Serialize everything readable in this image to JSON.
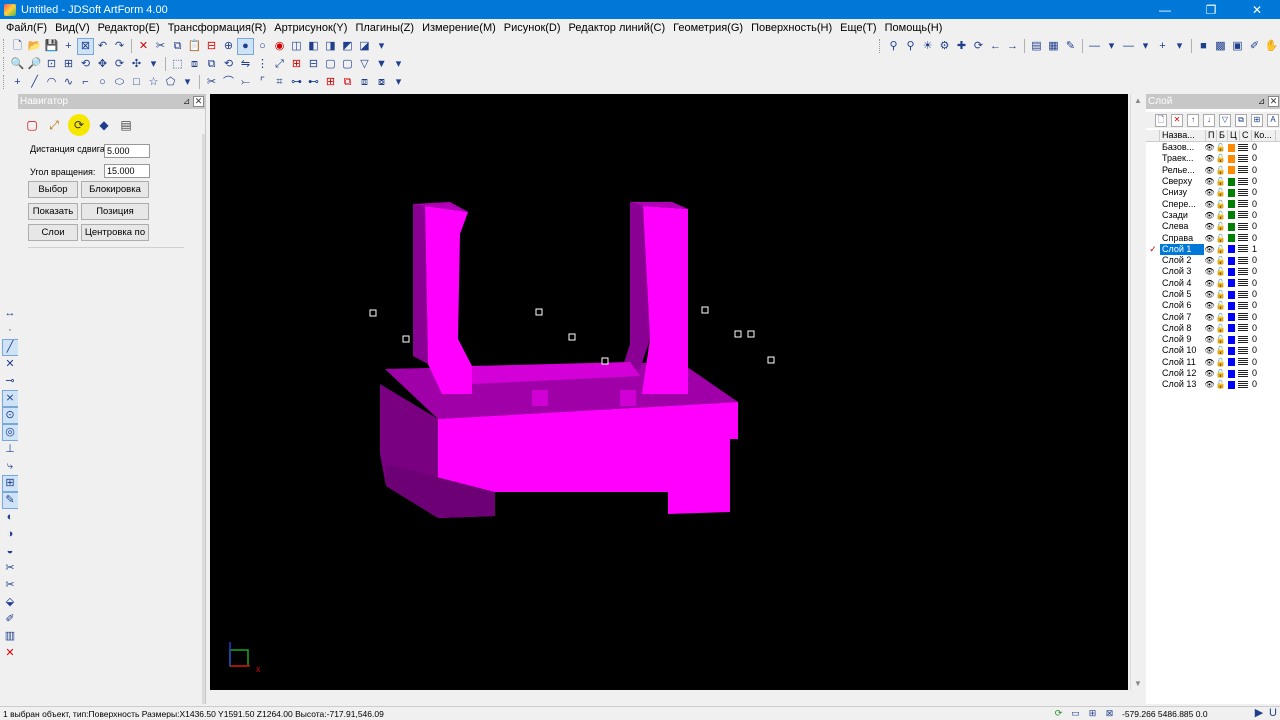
{
  "window": {
    "title": "Untitled - JDSoft ArtForm 4.00",
    "minimize": "—",
    "maximize": "❐",
    "close": "✕"
  },
  "menu": [
    "Файл(F)",
    "Вид(V)",
    "Редактор(E)",
    "Трансформация(R)",
    "Артрисунок(Y)",
    "Плагины(Z)",
    "Измерение(M)",
    "Рисунок(D)",
    "Редактор линий(C)",
    "Геометрия(G)",
    "Поверхность(H)",
    "Еще(T)",
    "Помощь(H)"
  ],
  "navigator": {
    "title": "Навигатор",
    "shift_label": "Дистанция сдвига:",
    "shift_value": "5.000",
    "rotate_label": "Угол вращения:",
    "rotate_value": "15.000",
    "buttons": {
      "select": "Выбор",
      "lock": "Блокировка",
      "show": "Показать",
      "position": "Позиция",
      "layers": "Слои",
      "center": "Центровка по"
    }
  },
  "layers": {
    "title": "Слой",
    "columns": [
      "Назва...",
      "П",
      "Б",
      "Ц",
      "С",
      "Ко..."
    ],
    "rows": [
      {
        "name": "Базов...",
        "color": "#ff8c00",
        "count": "0",
        "selected": false
      },
      {
        "name": "Траек...",
        "color": "#ff8c00",
        "count": "0",
        "selected": false
      },
      {
        "name": "Релье...",
        "color": "#ff8c00",
        "count": "0",
        "selected": false
      },
      {
        "name": "Сверху",
        "color": "#008000",
        "count": "0",
        "selected": false
      },
      {
        "name": "Снизу",
        "color": "#008000",
        "count": "0",
        "selected": false
      },
      {
        "name": "Спере...",
        "color": "#008000",
        "count": "0",
        "selected": false
      },
      {
        "name": "Сзади",
        "color": "#008000",
        "count": "0",
        "selected": false
      },
      {
        "name": "Слева",
        "color": "#008000",
        "count": "0",
        "selected": false
      },
      {
        "name": "Справа",
        "color": "#008000",
        "count": "0",
        "selected": false
      },
      {
        "name": "Слой 1",
        "color": "#0000ff",
        "count": "1",
        "selected": true
      },
      {
        "name": "Слой 2",
        "color": "#0000ff",
        "count": "0",
        "selected": false
      },
      {
        "name": "Слой 3",
        "color": "#0000ff",
        "count": "0",
        "selected": false
      },
      {
        "name": "Слой 4",
        "color": "#0000ff",
        "count": "0",
        "selected": false
      },
      {
        "name": "Слой 5",
        "color": "#0000ff",
        "count": "0",
        "selected": false
      },
      {
        "name": "Слой 6",
        "color": "#0000ff",
        "count": "0",
        "selected": false
      },
      {
        "name": "Слой 7",
        "color": "#0000ff",
        "count": "0",
        "selected": false
      },
      {
        "name": "Слой 8",
        "color": "#0000ff",
        "count": "0",
        "selected": false
      },
      {
        "name": "Слой 9",
        "color": "#0000ff",
        "count": "0",
        "selected": false
      },
      {
        "name": "Слой 10",
        "color": "#0000ff",
        "count": "0",
        "selected": false
      },
      {
        "name": "Слой 11",
        "color": "#0000ff",
        "count": "0",
        "selected": false
      },
      {
        "name": "Слой 12",
        "color": "#0000ff",
        "count": "0",
        "selected": false
      },
      {
        "name": "Слой 13",
        "color": "#0000ff",
        "count": "0",
        "selected": false
      }
    ]
  },
  "status": {
    "message": "1 выбран объект, тип:Поверхность  Размеры:X1436.50 Y1591.50 Z1264.00 Высота:-717.91,546.09",
    "coords": "-579.266  5486.885  0.0"
  },
  "colors": {
    "accent": "#0078d7",
    "model": "#ff00ff",
    "model_shade": "#a000a8",
    "model_dark": "#700078",
    "viewport_bg": "#000000"
  }
}
